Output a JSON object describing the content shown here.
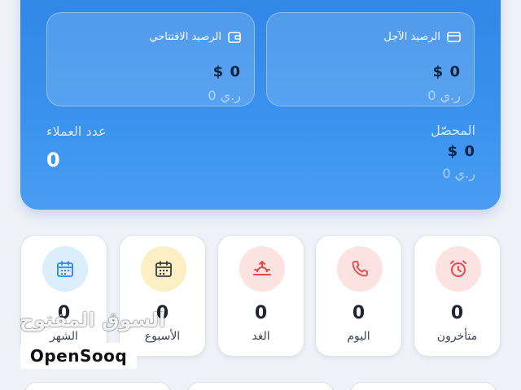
{
  "balances": {
    "deferred": {
      "label": "الرصيد الآجل",
      "amount": "$ 0",
      "currency": "0 ر.ي",
      "icon": "card-icon"
    },
    "opening": {
      "label": "الرصيد الافتتاحي",
      "amount": "$ 0",
      "currency": "0 ر.ي",
      "icon": "wallet-icon"
    },
    "collected": {
      "label": "المحصّل",
      "amount": "$ 0",
      "currency": "0 ر.ي"
    },
    "clients": {
      "label": "عدد العملاء",
      "count": "0"
    }
  },
  "tiles": [
    {
      "label": "متأخرون",
      "count": "0",
      "icon": "alarm-clock-icon",
      "color": "#e5484d"
    },
    {
      "label": "اليوم",
      "count": "0",
      "icon": "phone-icon",
      "color": "#e5484d"
    },
    {
      "label": "الغد",
      "count": "0",
      "icon": "sunrise-icon",
      "color": "#e5484d"
    },
    {
      "label": "الأسبوع",
      "count": "0",
      "icon": "calendar-icon",
      "color": "#3a3a3a"
    },
    {
      "label": "الشهر",
      "count": "0",
      "icon": "calendar-month-icon",
      "color": "#2e86de"
    }
  ],
  "watermark": {
    "arabic": "السوق المفتوح",
    "english": "OpenSooq"
  },
  "colors": {
    "hero": "#3b92ee",
    "accent_red": "#e5484d"
  }
}
